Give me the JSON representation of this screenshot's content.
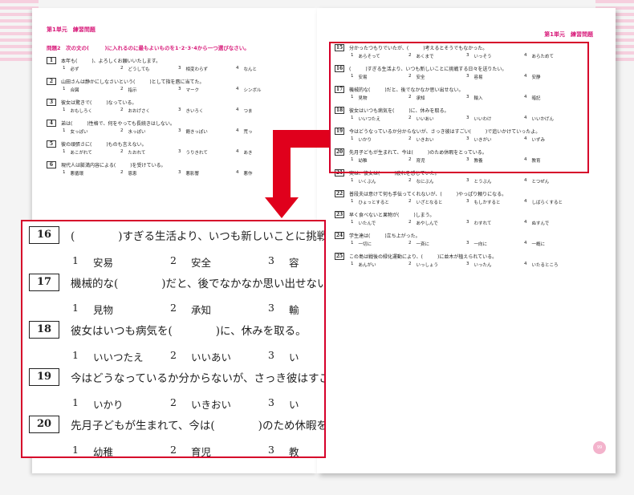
{
  "left_page": {
    "unit_title": "第1単元　練習問題",
    "instruction": "問題2　次の文の(　　　)に入れるのに最もよいものを1･2･3･4から一つ選びなさい。",
    "questions": [
      {
        "num": "1",
        "text": "本年も(　　　)、よろしくお願いいたします。",
        "opts": [
          [
            "1",
            "必ず"
          ],
          [
            "2",
            "どうしても"
          ],
          [
            "3",
            "相変わらず"
          ],
          [
            "4",
            "なんと"
          ]
        ]
      },
      {
        "num": "2",
        "text": "山田さんは静かにしなさいという(　　　)として指を唇に当てた。",
        "opts": [
          [
            "1",
            "合図"
          ],
          [
            "2",
            "指示"
          ],
          [
            "3",
            "マーク"
          ],
          [
            "4",
            "シンボル"
          ]
        ]
      },
      {
        "num": "3",
        "text": "彼女は驚きで(　　　)なっている。",
        "opts": [
          [
            "1",
            "おもしろく"
          ],
          [
            "2",
            "おおげさく"
          ],
          [
            "3",
            "きいろく"
          ],
          [
            "4",
            "つま"
          ]
        ]
      },
      {
        "num": "4",
        "text": "弟は(　　　)性格で、何をやっても長続きはしない。",
        "opts": [
          [
            "1",
            "女っぽい"
          ],
          [
            "2",
            "水っぽい"
          ],
          [
            "3",
            "飽きっぽい"
          ],
          [
            "4",
            "荒っ"
          ]
        ]
      },
      {
        "num": "5",
        "text": "彼の頑張さに(　　　)ものも言えない。",
        "opts": [
          [
            "1",
            "あこがれて"
          ],
          [
            "2",
            "たおれて"
          ],
          [
            "3",
            "うりきれて"
          ],
          [
            "4",
            "あき"
          ]
        ]
      },
      {
        "num": "6",
        "text": "現代人は膨満内容による(　　　)を受けている。",
        "opts": [
          [
            "1",
            "悪循環"
          ],
          [
            "2",
            "恩恵"
          ],
          [
            "3",
            "悪影響"
          ],
          [
            "4",
            "悪作"
          ]
        ]
      }
    ]
  },
  "right_page": {
    "unit_title": "第1単元　練習問題",
    "page_number": "99",
    "questions": [
      {
        "num": "15",
        "text": "分かったつもりでいたが、(　　　)考えるとそうでもなかった。",
        "opts": [
          [
            "1",
            "あらそって"
          ],
          [
            "2",
            "あくまで"
          ],
          [
            "3",
            "いっそう"
          ],
          [
            "4",
            "あらためて"
          ]
        ]
      },
      {
        "num": "16",
        "text": "(　　　)すぎる生活より、いつも新しいことに挑戦する日々を送りたい。",
        "opts": [
          [
            "1",
            "安易"
          ],
          [
            "2",
            "安全"
          ],
          [
            "3",
            "容易"
          ],
          [
            "4",
            "安静"
          ]
        ]
      },
      {
        "num": "17",
        "text": "機械的な(　　　)だと、後でなかなか思い出せない。",
        "opts": [
          [
            "1",
            "見物"
          ],
          [
            "2",
            "承知"
          ],
          [
            "3",
            "輸入"
          ],
          [
            "4",
            "暗記"
          ]
        ]
      },
      {
        "num": "18",
        "text": "彼女はいつも病気を(　　　)に、休みを取る。",
        "opts": [
          [
            "1",
            "いいつたえ"
          ],
          [
            "2",
            "いいあい"
          ],
          [
            "3",
            "いいわけ"
          ],
          [
            "4",
            "いいかげん"
          ]
        ]
      },
      {
        "num": "19",
        "text": "今はどうなっているか分からないが、さっき彼はすごい(　　　)で追いかけていったよ。",
        "opts": [
          [
            "1",
            "いかり"
          ],
          [
            "2",
            "いきおい"
          ],
          [
            "3",
            "いきがい"
          ],
          [
            "4",
            "いずみ"
          ]
        ]
      },
      {
        "num": "20",
        "text": "先月子どもが生まれて、今は(　　　)のため休暇をとっている。",
        "opts": [
          [
            "1",
            "幼稚"
          ],
          [
            "2",
            "育児"
          ],
          [
            "3",
            "教養"
          ],
          [
            "4",
            "教育"
          ]
        ]
      },
      {
        "num": "21",
        "text": "実は、彼女は(　　　)疲れを感じていた。",
        "opts": [
          [
            "1",
            "いくぶん"
          ],
          [
            "2",
            "なにぶん"
          ],
          [
            "3",
            "とうぶん"
          ],
          [
            "4",
            "とつぜん"
          ]
        ]
      },
      {
        "num": "22",
        "text": "普段夫は意けて何も手伝ってくれないが、(　　　)やっぱり頼りになる。",
        "opts": [
          [
            "1",
            "ひょっとすると"
          ],
          [
            "2",
            "いざとなると"
          ],
          [
            "3",
            "もしかすると"
          ],
          [
            "4",
            "しばらくすると"
          ]
        ]
      },
      {
        "num": "23",
        "text": "早く食べないと果物が(　　　)しまう。",
        "opts": [
          [
            "1",
            "いたんで"
          ],
          [
            "2",
            "あやしんで"
          ],
          [
            "3",
            "わすれて"
          ],
          [
            "4",
            "ぬすんで"
          ]
        ]
      },
      {
        "num": "24",
        "text": "学生達は(　　　)立ち上がった。",
        "opts": [
          [
            "1",
            "一切に"
          ],
          [
            "2",
            "一斉に"
          ],
          [
            "3",
            "一向に"
          ],
          [
            "4",
            "一概に"
          ]
        ]
      },
      {
        "num": "25",
        "text": "この島は戦後の緑化運動により、(　　　)に並木が植えられている。",
        "opts": [
          [
            "1",
            "あんがい"
          ],
          [
            "2",
            "いっしょう"
          ],
          [
            "3",
            "いったん"
          ],
          [
            "4",
            "いたるところ"
          ]
        ]
      }
    ]
  },
  "zoom": {
    "questions": [
      {
        "num": "16",
        "text": "(　　　　)すぎる生活より、いつも新しいことに挑戦",
        "opts": [
          [
            "1",
            "安易"
          ],
          [
            "2",
            "安全"
          ],
          [
            "3",
            "容"
          ]
        ]
      },
      {
        "num": "17",
        "text": "機械的な(　　　　)だと、後でなかなか思い出せない",
        "opts": [
          [
            "1",
            "見物"
          ],
          [
            "2",
            "承知"
          ],
          [
            "3",
            "輸"
          ]
        ]
      },
      {
        "num": "18",
        "text": "彼女はいつも病気を(　　　　)に、休みを取る。",
        "opts": [
          [
            "1",
            "いいつたえ"
          ],
          [
            "2",
            "いいあい"
          ],
          [
            "3",
            "い"
          ]
        ]
      },
      {
        "num": "19",
        "text": "今はどうなっているか分からないが、さっき彼はすご",
        "opts": [
          [
            "1",
            "いかり"
          ],
          [
            "2",
            "いきおい"
          ],
          [
            "3",
            "い"
          ]
        ]
      },
      {
        "num": "20",
        "text": "先月子どもが生まれて、今は(　　　　)のため休暇を",
        "opts": [
          [
            "1",
            "幼稚"
          ],
          [
            "2",
            "育児"
          ],
          [
            "3",
            "教"
          ]
        ]
      }
    ]
  },
  "colors": {
    "accent": "#d81b7a",
    "highlight": "#d6002a"
  }
}
